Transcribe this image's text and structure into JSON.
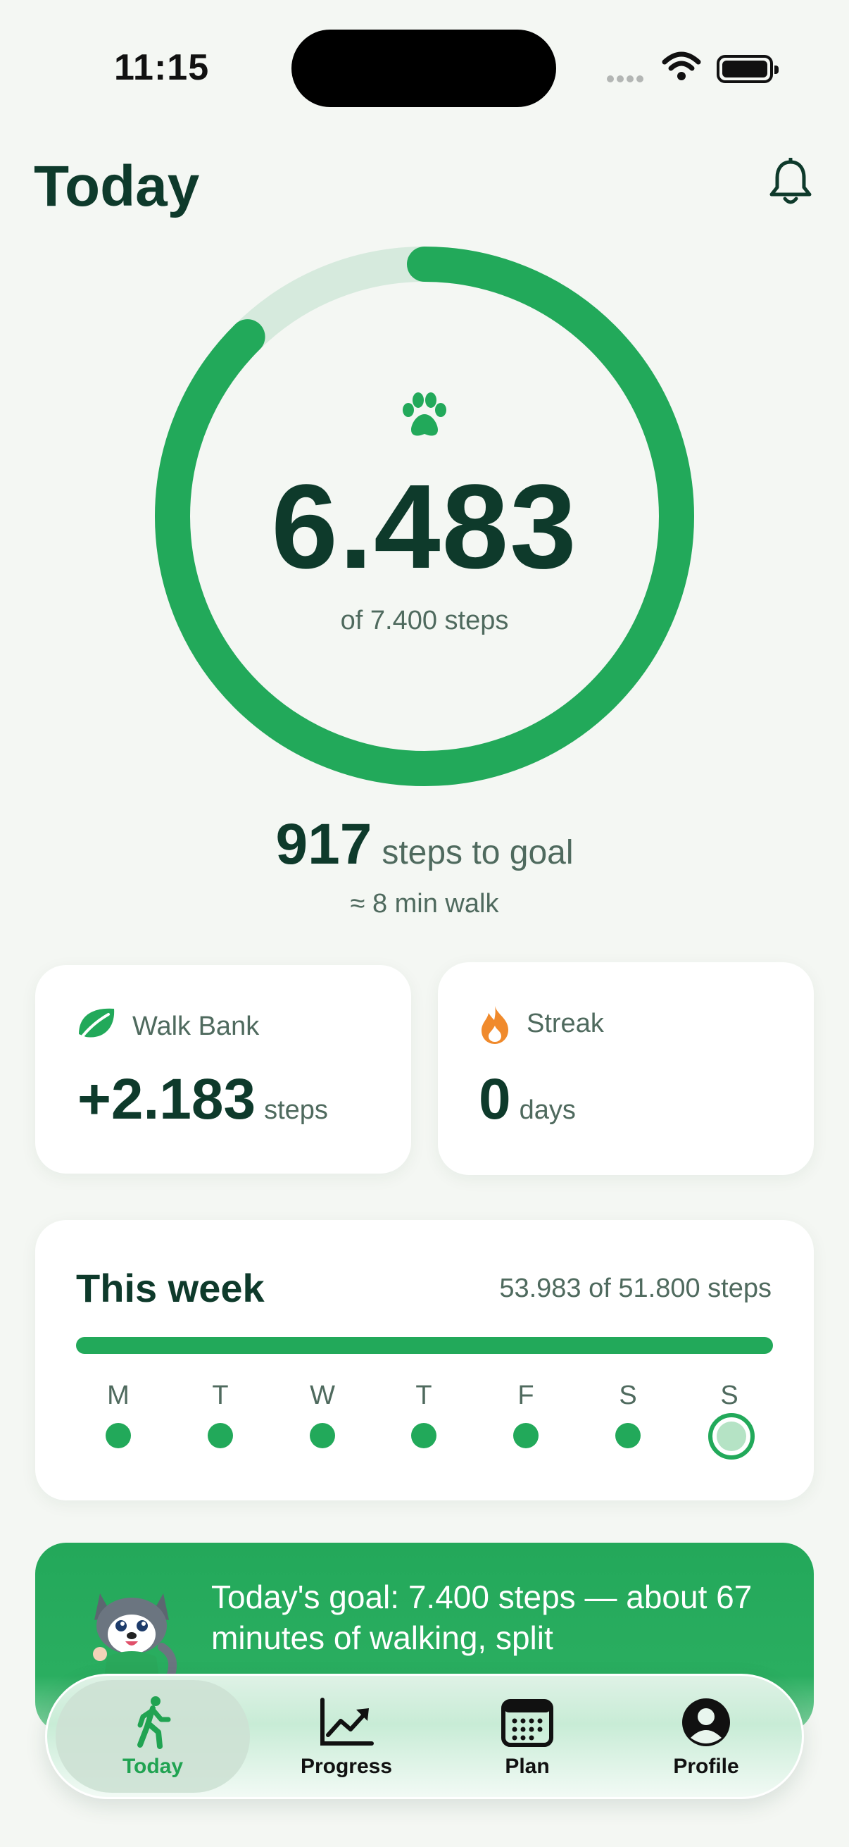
{
  "status_bar": {
    "time": "11:15"
  },
  "header": {
    "title": "Today"
  },
  "progress": {
    "steps": "6.483",
    "goal_label": "of 7.400 steps",
    "fraction": 0.876,
    "remaining": "917",
    "remaining_label": "steps to goal",
    "walk_estimate": "≈ 8 min walk"
  },
  "cards": {
    "walk_bank": {
      "label": "Walk Bank",
      "value": "+2.183",
      "unit": "steps"
    },
    "streak": {
      "label": "Streak",
      "value": "0",
      "unit": "days"
    }
  },
  "week": {
    "title": "This week",
    "summary": "53.983 of 51.800 steps",
    "days": [
      "M",
      "T",
      "W",
      "T",
      "F",
      "S",
      "S"
    ]
  },
  "promo": {
    "text": "Today's goal: 7.400 steps — about 67 minutes of walking, split"
  },
  "tabs": [
    {
      "label": "Today"
    },
    {
      "label": "Progress"
    },
    {
      "label": "Plan"
    },
    {
      "label": "Profile"
    }
  ],
  "colors": {
    "accent": "#22a95a",
    "text_dark": "#0e3a2b",
    "muted": "#4f6a5e",
    "ring_track": "#d6eadd",
    "streak_flame": "#f08a2c"
  }
}
